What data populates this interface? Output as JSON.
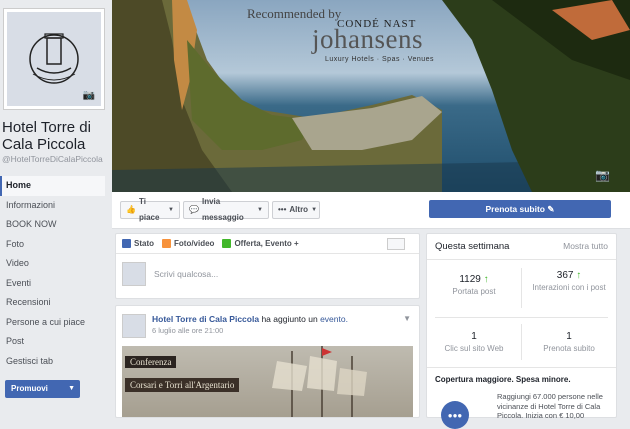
{
  "page": {
    "name": "Hotel Torre di Cala Piccola",
    "handle": "@HotelTorreDiCalaPiccola"
  },
  "nav": {
    "items": [
      {
        "label": "Home",
        "active": true
      },
      {
        "label": "Informazioni"
      },
      {
        "label": "BOOK NOW"
      },
      {
        "label": "Foto"
      },
      {
        "label": "Video"
      },
      {
        "label": "Eventi"
      },
      {
        "label": "Recensioni"
      },
      {
        "label": "Persone a cui piace"
      },
      {
        "label": "Post"
      },
      {
        "label": "Gestisci tab"
      }
    ],
    "promo_label": "Promuovi"
  },
  "cover": {
    "recommended": "Recommended by",
    "conde": "CONDÉ NAST",
    "johansens": "johansens",
    "tagline": "Luxury Hotels · Spas · Venues"
  },
  "actions": {
    "like": "Ti piace",
    "message": "Invia messaggio",
    "more": "Altro",
    "book": "Prenota subito"
  },
  "composer": {
    "tabs": [
      "Stato",
      "Foto/video",
      "Offerta, Evento +"
    ],
    "placeholder": "Scrivi qualcosa..."
  },
  "post": {
    "author": "Hotel Torre di Cala Piccola",
    "action": "ha aggiunto un",
    "object": "evento.",
    "time": "6 luglio alle ore 21:00",
    "image_title": "Conferenza",
    "image_subtitle": "Corsari e Torri all'Argentario"
  },
  "week": {
    "title": "Questa settimana",
    "more": "Mostra tutto",
    "stats": [
      {
        "value": "1129",
        "trend": "↑",
        "label": "Portata post"
      },
      {
        "value": "367",
        "trend": "↑",
        "label": "Interazioni con i post"
      },
      {
        "value": "1",
        "trend": "",
        "label": "Clic sul sito Web"
      },
      {
        "value": "1",
        "trend": "",
        "label": "Prenota subito"
      }
    ],
    "coverage_title": "Copertura maggiore. Spesa minore.",
    "coverage_desc": "Raggiungi 67.000 persone nelle vicinanze di Hotel Torre di Cala Piccola. Inizia con € 10,00"
  },
  "colors": {
    "accent": "#4267b2",
    "link": "#365899",
    "up": "#42b72a"
  }
}
